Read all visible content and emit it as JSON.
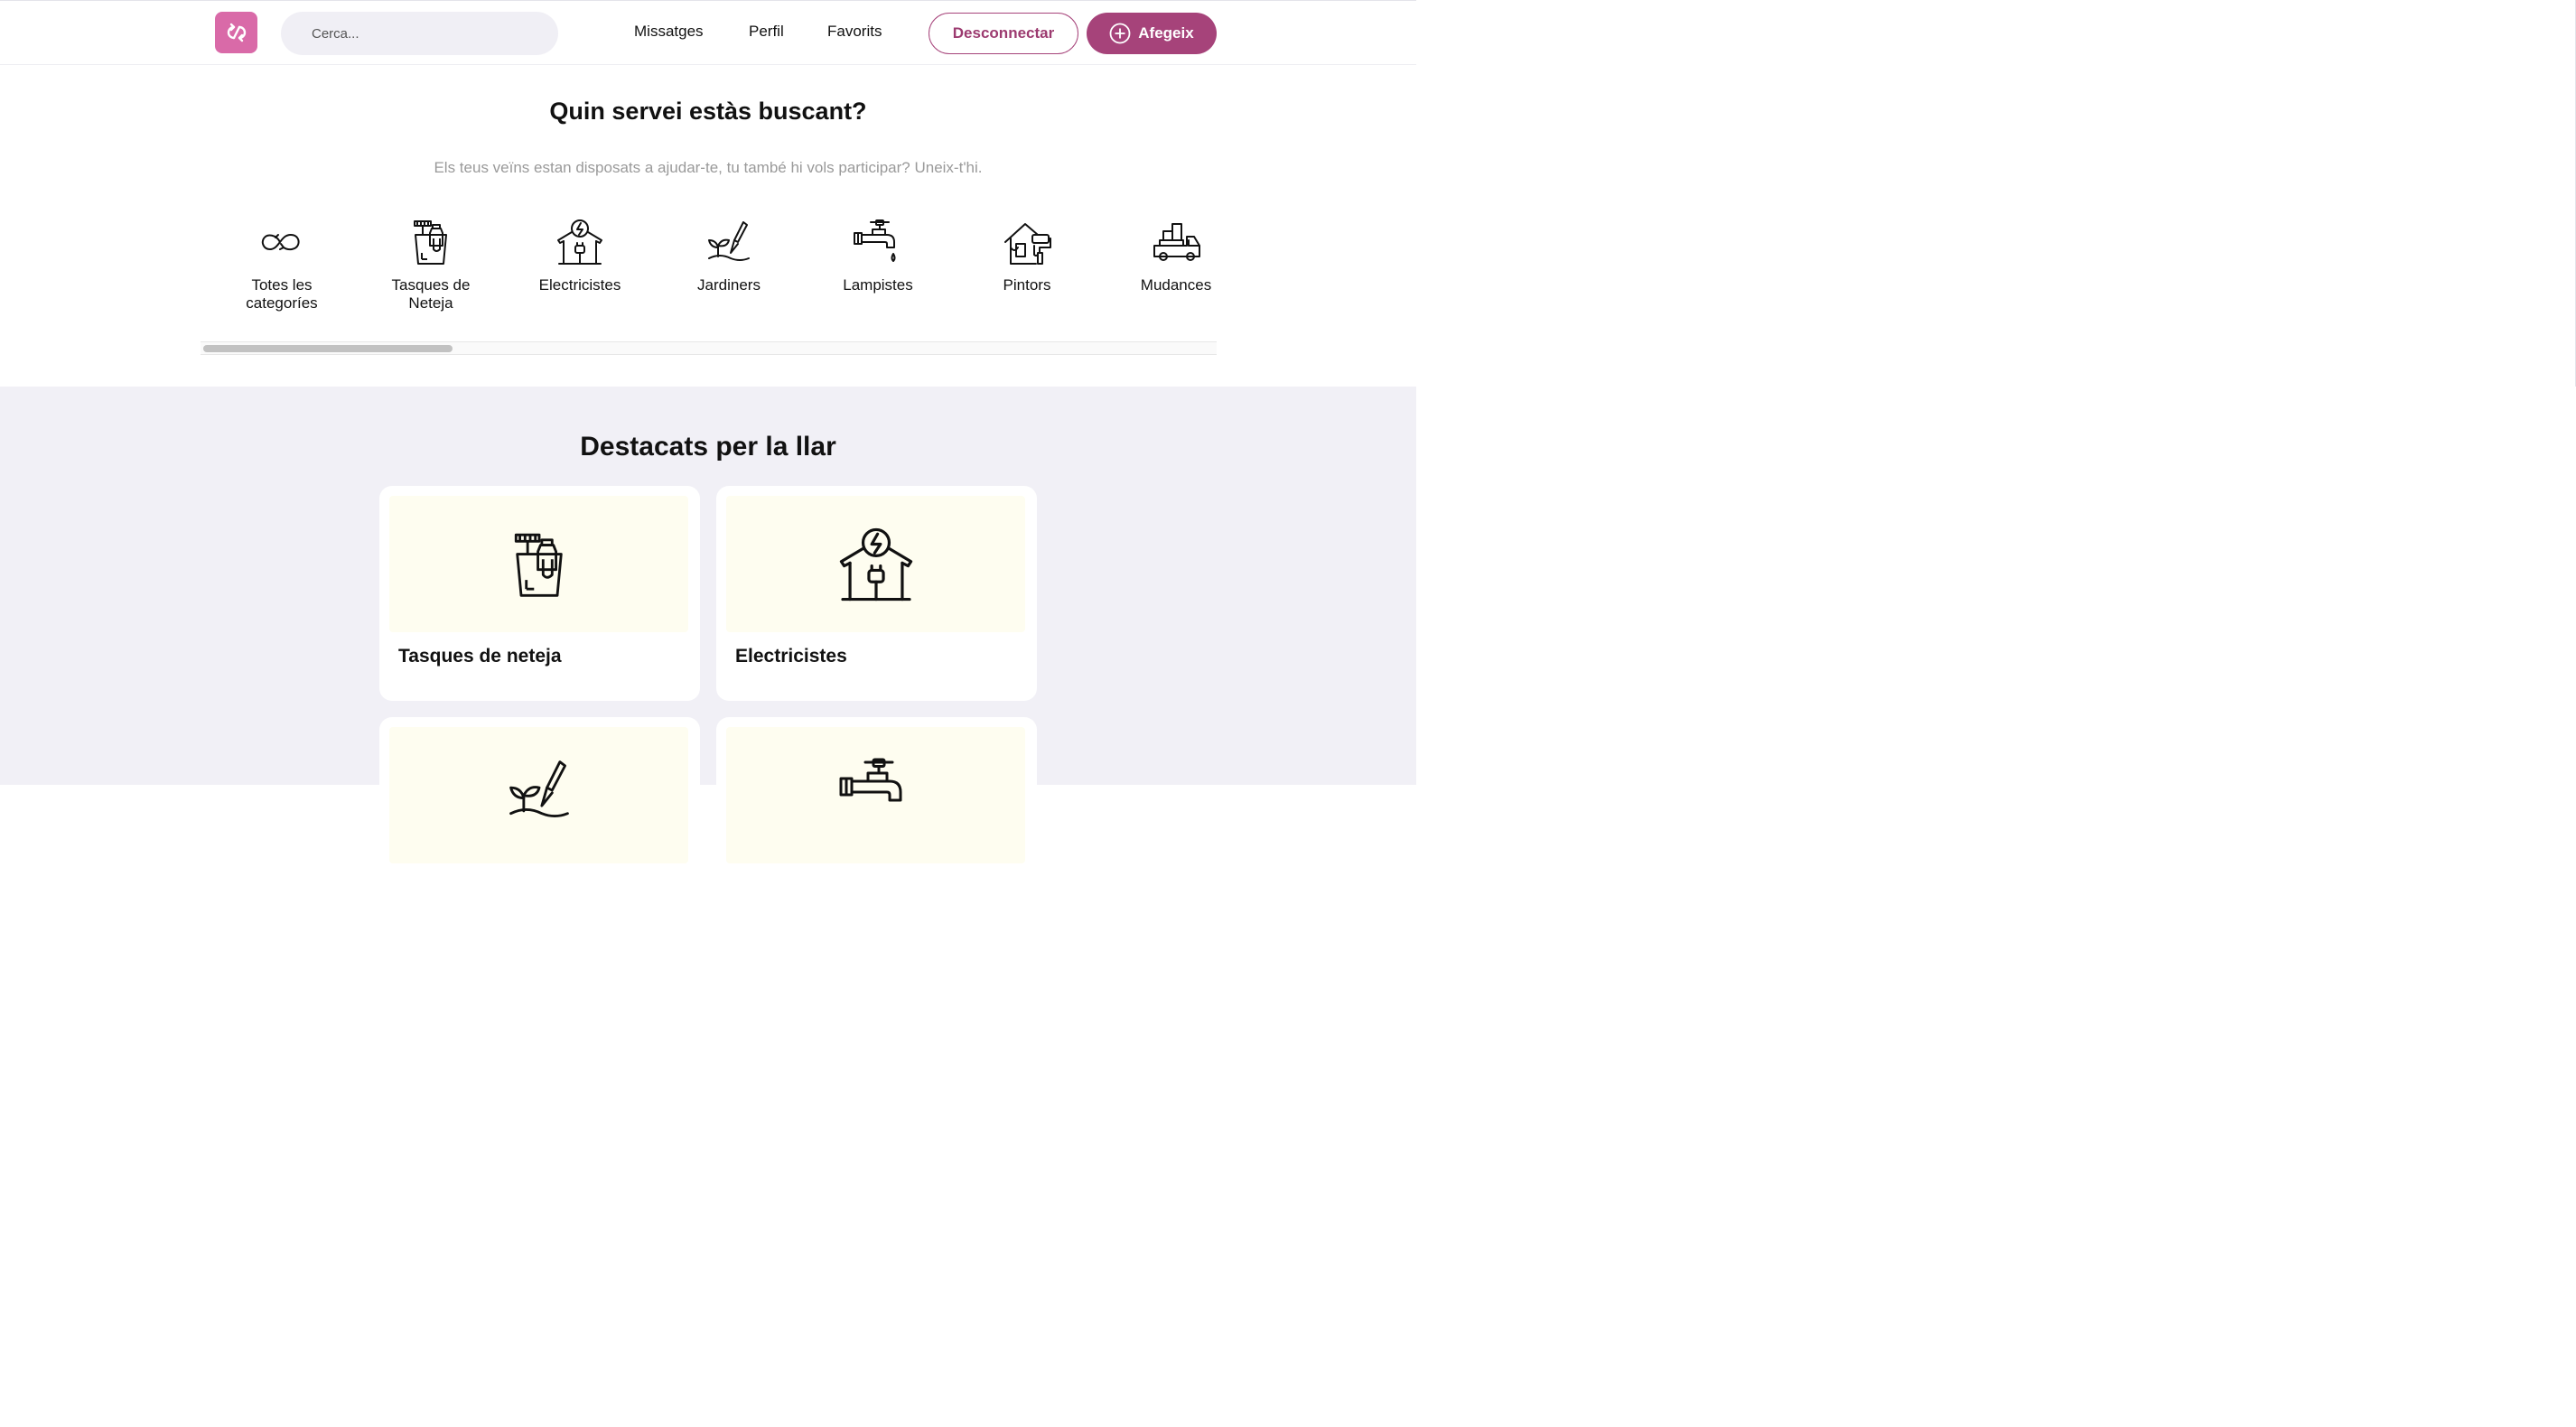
{
  "header": {
    "logo_icon": "recycle-loop-icon",
    "search_placeholder": "Cerca...",
    "nav": [
      "Missatges",
      "Perfil",
      "Favorits"
    ],
    "logout_label": "Desconnectar",
    "add_label": "Afegeix",
    "colors": {
      "brand": "#a6437a",
      "logo_bg": "#d96aa8"
    }
  },
  "hero": {
    "title": "Quin servei estàs buscant?",
    "subtitle": "Els teus veïns estan disposats a ajudar-te, tu també hi vols participar? Uneix-t'hi."
  },
  "categories": [
    {
      "label_line1": "Totes les",
      "label_line2": "categoríes",
      "icon": "infinity-loop-icon"
    },
    {
      "label_line1": "Tasques de",
      "label_line2": "Neteja",
      "icon": "cleaning-bucket-icon"
    },
    {
      "label_line1": "Electricistes",
      "label_line2": "",
      "icon": "electric-house-icon"
    },
    {
      "label_line1": "Jardiners",
      "label_line2": "",
      "icon": "gardening-icon"
    },
    {
      "label_line1": "Lampistes",
      "label_line2": "",
      "icon": "faucet-icon"
    },
    {
      "label_line1": "Pintors",
      "label_line2": "",
      "icon": "paint-house-icon"
    },
    {
      "label_line1": "Mudances",
      "label_line2": "",
      "icon": "moving-truck-icon"
    }
  ],
  "scroll": {
    "position_fraction": 0.0,
    "visible_fraction": 0.25
  },
  "featured": {
    "title": "Destacats per la llar",
    "cards": [
      {
        "title": "Tasques de neteja",
        "icon": "cleaning-bucket-icon"
      },
      {
        "title": "Electricistes",
        "icon": "electric-house-icon"
      },
      {
        "title": "",
        "icon": "gardening-icon"
      },
      {
        "title": "",
        "icon": "faucet-icon"
      }
    ],
    "colors": {
      "section_bg": "#f1f0f6",
      "card_image_bg": "#fefdf0"
    }
  }
}
